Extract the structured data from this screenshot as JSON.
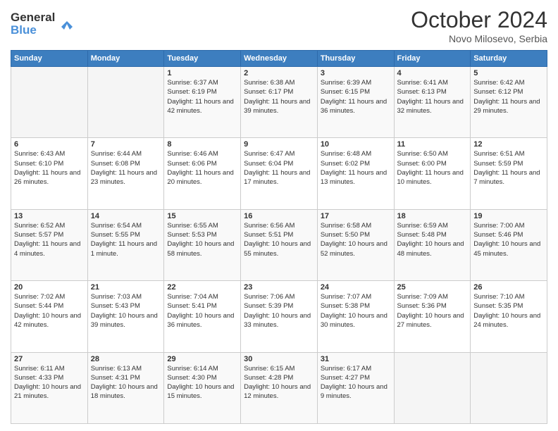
{
  "header": {
    "logo_line1": "General",
    "logo_line2": "Blue",
    "month": "October 2024",
    "location": "Novo Milosevo, Serbia"
  },
  "weekdays": [
    "Sunday",
    "Monday",
    "Tuesday",
    "Wednesday",
    "Thursday",
    "Friday",
    "Saturday"
  ],
  "weeks": [
    [
      {
        "day": "",
        "sunrise": "",
        "sunset": "",
        "daylight": ""
      },
      {
        "day": "",
        "sunrise": "",
        "sunset": "",
        "daylight": ""
      },
      {
        "day": "1",
        "sunrise": "Sunrise: 6:37 AM",
        "sunset": "Sunset: 6:19 PM",
        "daylight": "Daylight: 11 hours and 42 minutes."
      },
      {
        "day": "2",
        "sunrise": "Sunrise: 6:38 AM",
        "sunset": "Sunset: 6:17 PM",
        "daylight": "Daylight: 11 hours and 39 minutes."
      },
      {
        "day": "3",
        "sunrise": "Sunrise: 6:39 AM",
        "sunset": "Sunset: 6:15 PM",
        "daylight": "Daylight: 11 hours and 36 minutes."
      },
      {
        "day": "4",
        "sunrise": "Sunrise: 6:41 AM",
        "sunset": "Sunset: 6:13 PM",
        "daylight": "Daylight: 11 hours and 32 minutes."
      },
      {
        "day": "5",
        "sunrise": "Sunrise: 6:42 AM",
        "sunset": "Sunset: 6:12 PM",
        "daylight": "Daylight: 11 hours and 29 minutes."
      }
    ],
    [
      {
        "day": "6",
        "sunrise": "Sunrise: 6:43 AM",
        "sunset": "Sunset: 6:10 PM",
        "daylight": "Daylight: 11 hours and 26 minutes."
      },
      {
        "day": "7",
        "sunrise": "Sunrise: 6:44 AM",
        "sunset": "Sunset: 6:08 PM",
        "daylight": "Daylight: 11 hours and 23 minutes."
      },
      {
        "day": "8",
        "sunrise": "Sunrise: 6:46 AM",
        "sunset": "Sunset: 6:06 PM",
        "daylight": "Daylight: 11 hours and 20 minutes."
      },
      {
        "day": "9",
        "sunrise": "Sunrise: 6:47 AM",
        "sunset": "Sunset: 6:04 PM",
        "daylight": "Daylight: 11 hours and 17 minutes."
      },
      {
        "day": "10",
        "sunrise": "Sunrise: 6:48 AM",
        "sunset": "Sunset: 6:02 PM",
        "daylight": "Daylight: 11 hours and 13 minutes."
      },
      {
        "day": "11",
        "sunrise": "Sunrise: 6:50 AM",
        "sunset": "Sunset: 6:00 PM",
        "daylight": "Daylight: 11 hours and 10 minutes."
      },
      {
        "day": "12",
        "sunrise": "Sunrise: 6:51 AM",
        "sunset": "Sunset: 5:59 PM",
        "daylight": "Daylight: 11 hours and 7 minutes."
      }
    ],
    [
      {
        "day": "13",
        "sunrise": "Sunrise: 6:52 AM",
        "sunset": "Sunset: 5:57 PM",
        "daylight": "Daylight: 11 hours and 4 minutes."
      },
      {
        "day": "14",
        "sunrise": "Sunrise: 6:54 AM",
        "sunset": "Sunset: 5:55 PM",
        "daylight": "Daylight: 11 hours and 1 minute."
      },
      {
        "day": "15",
        "sunrise": "Sunrise: 6:55 AM",
        "sunset": "Sunset: 5:53 PM",
        "daylight": "Daylight: 10 hours and 58 minutes."
      },
      {
        "day": "16",
        "sunrise": "Sunrise: 6:56 AM",
        "sunset": "Sunset: 5:51 PM",
        "daylight": "Daylight: 10 hours and 55 minutes."
      },
      {
        "day": "17",
        "sunrise": "Sunrise: 6:58 AM",
        "sunset": "Sunset: 5:50 PM",
        "daylight": "Daylight: 10 hours and 52 minutes."
      },
      {
        "day": "18",
        "sunrise": "Sunrise: 6:59 AM",
        "sunset": "Sunset: 5:48 PM",
        "daylight": "Daylight: 10 hours and 48 minutes."
      },
      {
        "day": "19",
        "sunrise": "Sunrise: 7:00 AM",
        "sunset": "Sunset: 5:46 PM",
        "daylight": "Daylight: 10 hours and 45 minutes."
      }
    ],
    [
      {
        "day": "20",
        "sunrise": "Sunrise: 7:02 AM",
        "sunset": "Sunset: 5:44 PM",
        "daylight": "Daylight: 10 hours and 42 minutes."
      },
      {
        "day": "21",
        "sunrise": "Sunrise: 7:03 AM",
        "sunset": "Sunset: 5:43 PM",
        "daylight": "Daylight: 10 hours and 39 minutes."
      },
      {
        "day": "22",
        "sunrise": "Sunrise: 7:04 AM",
        "sunset": "Sunset: 5:41 PM",
        "daylight": "Daylight: 10 hours and 36 minutes."
      },
      {
        "day": "23",
        "sunrise": "Sunrise: 7:06 AM",
        "sunset": "Sunset: 5:39 PM",
        "daylight": "Daylight: 10 hours and 33 minutes."
      },
      {
        "day": "24",
        "sunrise": "Sunrise: 7:07 AM",
        "sunset": "Sunset: 5:38 PM",
        "daylight": "Daylight: 10 hours and 30 minutes."
      },
      {
        "day": "25",
        "sunrise": "Sunrise: 7:09 AM",
        "sunset": "Sunset: 5:36 PM",
        "daylight": "Daylight: 10 hours and 27 minutes."
      },
      {
        "day": "26",
        "sunrise": "Sunrise: 7:10 AM",
        "sunset": "Sunset: 5:35 PM",
        "daylight": "Daylight: 10 hours and 24 minutes."
      }
    ],
    [
      {
        "day": "27",
        "sunrise": "Sunrise: 6:11 AM",
        "sunset": "Sunset: 4:33 PM",
        "daylight": "Daylight: 10 hours and 21 minutes."
      },
      {
        "day": "28",
        "sunrise": "Sunrise: 6:13 AM",
        "sunset": "Sunset: 4:31 PM",
        "daylight": "Daylight: 10 hours and 18 minutes."
      },
      {
        "day": "29",
        "sunrise": "Sunrise: 6:14 AM",
        "sunset": "Sunset: 4:30 PM",
        "daylight": "Daylight: 10 hours and 15 minutes."
      },
      {
        "day": "30",
        "sunrise": "Sunrise: 6:15 AM",
        "sunset": "Sunset: 4:28 PM",
        "daylight": "Daylight: 10 hours and 12 minutes."
      },
      {
        "day": "31",
        "sunrise": "Sunrise: 6:17 AM",
        "sunset": "Sunset: 4:27 PM",
        "daylight": "Daylight: 10 hours and 9 minutes."
      },
      {
        "day": "",
        "sunrise": "",
        "sunset": "",
        "daylight": ""
      },
      {
        "day": "",
        "sunrise": "",
        "sunset": "",
        "daylight": ""
      }
    ]
  ]
}
